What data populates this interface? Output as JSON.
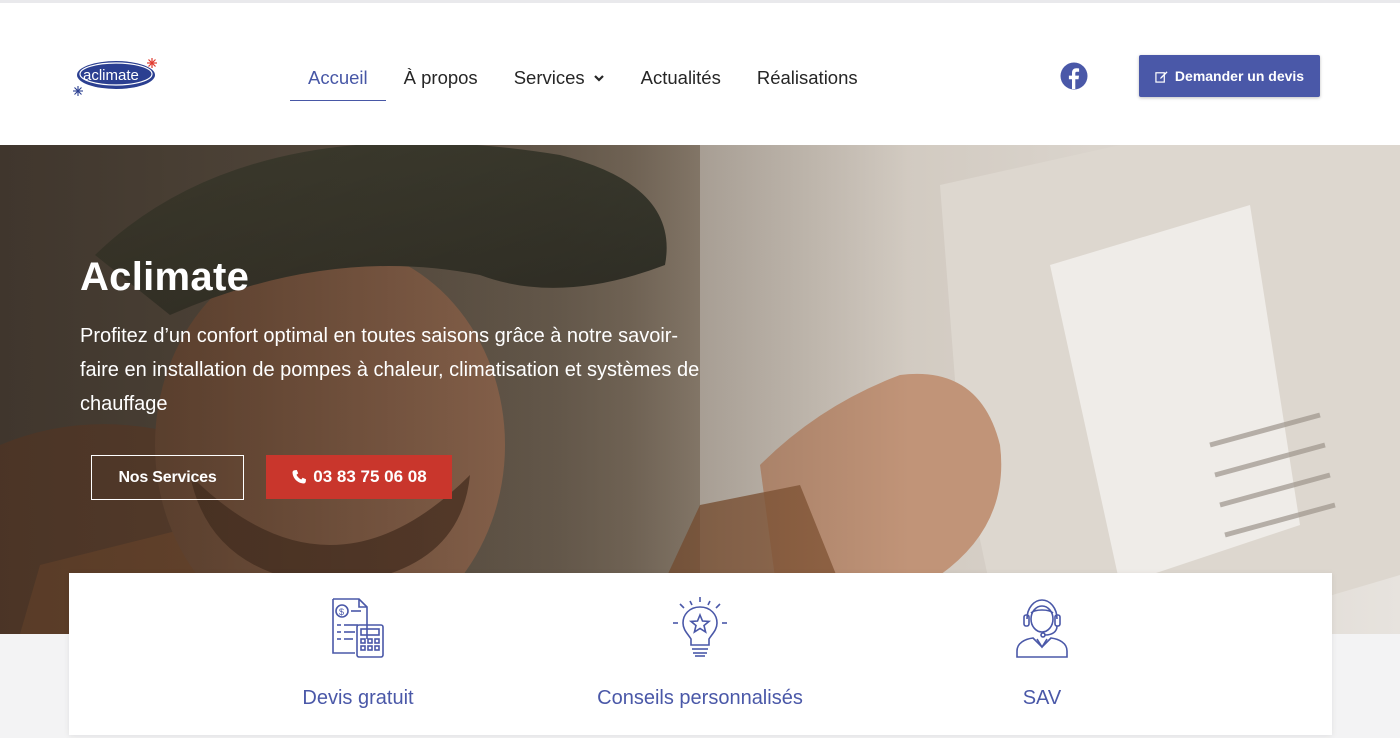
{
  "header": {
    "logo_text": "aclimate",
    "nav": [
      {
        "label": "Accueil",
        "active": true
      },
      {
        "label": "À propos",
        "active": false
      },
      {
        "label": "Services",
        "active": false,
        "has_dropdown": true
      },
      {
        "label": "Actualités",
        "active": false
      },
      {
        "label": "Réalisations",
        "active": false
      }
    ],
    "social_icon": "facebook-icon",
    "cta_label": "Demander un devis",
    "cta_icon": "edit-icon"
  },
  "hero": {
    "title": "Aclimate",
    "text": "Profitez d’un confort optimal en toutes saisons grâce à notre savoir-faire en installation de pompes à chaleur, climatisation et systèmes de chauffage",
    "btn_services": "Nos Services",
    "btn_phone": "03 83 75 06 08"
  },
  "features": [
    {
      "label": "Devis gratuit",
      "icon": "invoice-calculator-icon"
    },
    {
      "label": "Conseils personnalisés",
      "icon": "lightbulb-star-icon"
    },
    {
      "label": "SAV",
      "icon": "support-headset-icon"
    }
  ],
  "colors": {
    "accent": "#4a58a8",
    "phone_button": "#c9362c",
    "logo_blue": "#2b3f91",
    "logo_red": "#e03a2f"
  }
}
